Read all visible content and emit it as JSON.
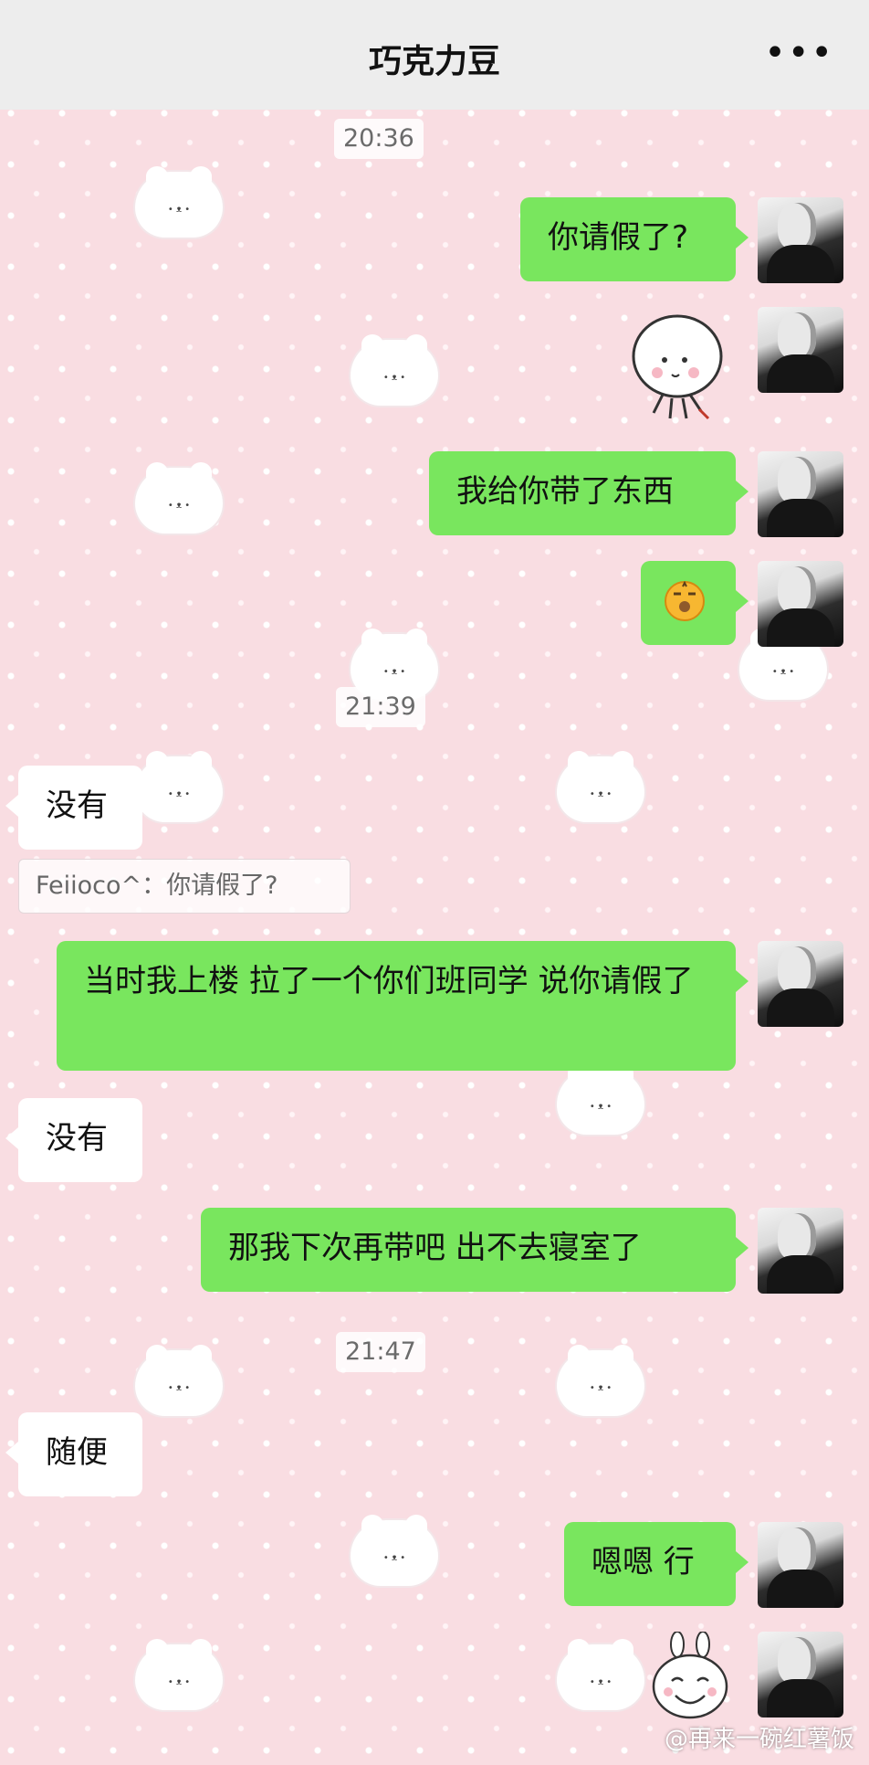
{
  "header": {
    "title": "巧克力豆",
    "more_icon": "more-options-icon"
  },
  "messages": [
    {
      "type": "time",
      "text": "20:36"
    },
    {
      "type": "bubble",
      "from": "me",
      "text": "你请假了?"
    },
    {
      "type": "sticker",
      "from": "me",
      "icon": "cute-doll-sticker"
    },
    {
      "type": "bubble",
      "from": "me",
      "text": "我给你带了东西"
    },
    {
      "type": "emoji",
      "from": "me",
      "icon": "shushing-face-emoji"
    },
    {
      "type": "time",
      "text": "21:39"
    },
    {
      "type": "bubble",
      "from": "them",
      "text": "没有"
    },
    {
      "type": "quote",
      "text": "Feiioco^：你请假了?"
    },
    {
      "type": "bubble",
      "from": "me",
      "text": "当时我上楼 拉了一个你们班同学 说你请假了"
    },
    {
      "type": "bubble",
      "from": "them",
      "text": "没有"
    },
    {
      "type": "bubble",
      "from": "me",
      "text": "那我下次再带吧 出不去寝室了"
    },
    {
      "type": "time",
      "text": "21:47"
    },
    {
      "type": "bubble",
      "from": "them",
      "text": "随便"
    },
    {
      "type": "bubble",
      "from": "me",
      "text": "嗯嗯 行"
    },
    {
      "type": "sticker",
      "from": "me",
      "icon": "bunny-smile-sticker"
    }
  ],
  "watermark": "@再来一碗红薯饭",
  "colors": {
    "my_bubble": "#79e65e",
    "their_bubble": "#ffffff",
    "background": "#f9dde2",
    "header": "#ededed"
  }
}
